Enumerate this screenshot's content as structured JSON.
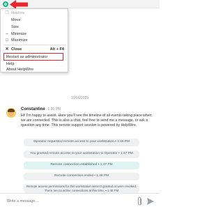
{
  "menu": {
    "restore": "Restore",
    "move": "Move",
    "size": "Size",
    "minimize": "Minimize",
    "maximize": "Maximize",
    "close": "Close",
    "close_shortcut": "Alt + F4",
    "restart_admin": "Restart as administrator",
    "help": "Help",
    "about": "About HelpWire"
  },
  "chat": {
    "date": "10/16/2023",
    "sender": "Constantine",
    "time": "1:39 PM",
    "message": "Hi! I'm happy to assist. Here you'll see the timeline of all events taking place when we are connected. This is also a chat, feel free to send me a message, or ask a question any time. This remote support session is powered by HelpWire.",
    "events": [
      "Operator requested remote access to your workstation • 1:46 PM",
      "You granted remote access to your workstation to Operator • 1:47 PM",
      "Remote connection established • 1:47 PM",
      "Remote connection ended • 1:48 PM",
      "Remote access permissions for this workstation weren't granted or were revoked. There are no active connections at this time. • 1:48 PM"
    ]
  },
  "input": {
    "placeholder": "Write a message ..."
  },
  "colors": {
    "accent_red": "#e8262b",
    "brand_green": "#1fb38a",
    "event_gray": "#eef0f2",
    "event_teal": "#dff3f2"
  }
}
